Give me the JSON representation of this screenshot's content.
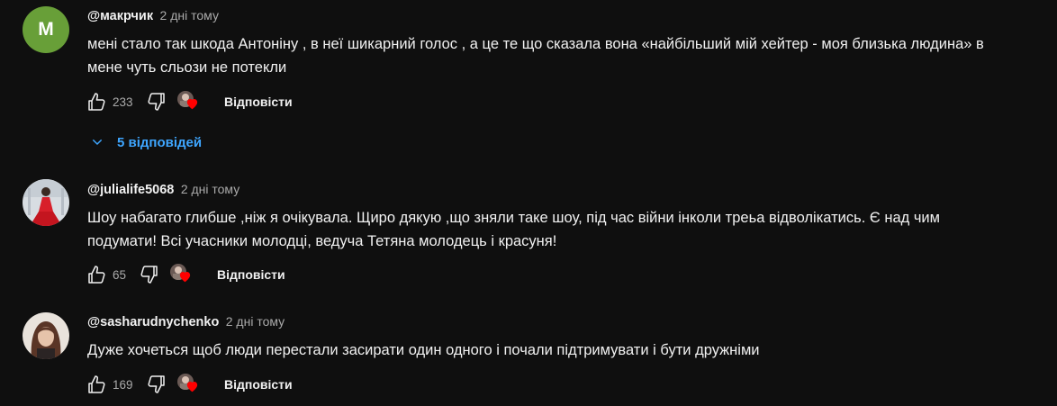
{
  "comments": [
    {
      "author": "@макрчик",
      "time": "2 дні тому",
      "avatar_letter": "M",
      "avatar_color": "#689f38",
      "text_lines": [
        "мені стало так шкода Антоніну , в неї шикарний голос , а це те що сказала вона «найбільший мій хейтер - моя близька людина» в",
        "мене чуть сльози не потекли"
      ],
      "likes": "233",
      "reply_label": "Відповісти",
      "replies_toggle": "5 відповідей"
    },
    {
      "author": "@julialife5068",
      "time": "2 дні тому",
      "text_lines": [
        "Шоу набагато глибше ,ніж я очікувала. Щиро дякую ,що зняли таке шоу, під час війни інколи треьа відволікатись. Є над чим",
        "подумати! Всі учасники молодці, ведуча Тетяна молодець і  красуня!"
      ],
      "likes": "65",
      "reply_label": "Відповісти"
    },
    {
      "author": "@sasharudnychenko",
      "time": "2 дні тому",
      "text_lines": [
        "Дуже хочеться щоб люди перестали засирати один одного і почали підтримувати і бути дружніми"
      ],
      "likes": "169",
      "reply_label": "Відповісти"
    }
  ],
  "icons": {
    "like": "thumb-up-icon",
    "dislike": "thumb-down-icon",
    "creator_heart": "heart-icon",
    "expand": "chevron-down-icon"
  },
  "colors": {
    "background": "#0f0f0f",
    "text": "#f1f1f1",
    "secondary": "#aaaaaa",
    "link": "#3ea6ff",
    "heart": "#ff0000"
  }
}
